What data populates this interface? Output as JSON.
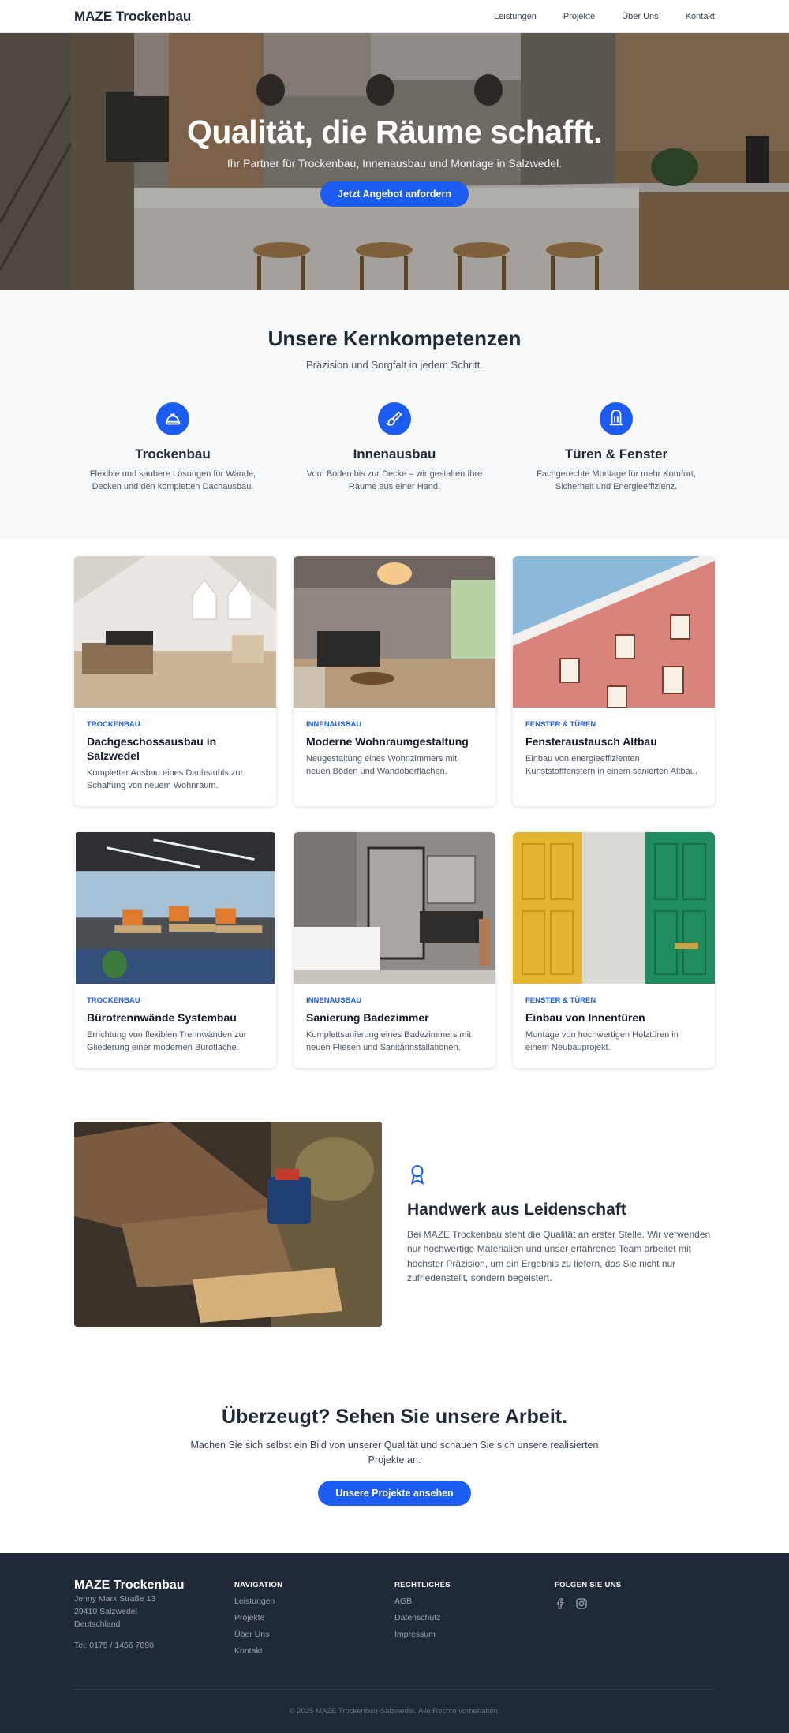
{
  "header": {
    "brand": "MAZE Trockenbau",
    "nav": [
      "Leistungen",
      "Projekte",
      "Über Uns",
      "Kontakt"
    ]
  },
  "hero": {
    "title": "Qualität, die Räume schafft.",
    "subtitle": "Ihr Partner für Trockenbau, Innenausbau und Montage in Salzwedel.",
    "cta_label": "Jetzt Angebot anfordern"
  },
  "competences": {
    "title": "Unsere Kernkompetenzen",
    "subtitle": "Präzision und Sorgfalt in jedem Schritt.",
    "items": [
      {
        "icon": "hard-hat-icon",
        "name": "Trockenbau",
        "desc": "Flexible und saubere Lösungen für Wände, Decken und den kompletten Dachausbau."
      },
      {
        "icon": "paint-brush-icon",
        "name": "Innenausbau",
        "desc": "Vom Boden bis zur Decke – wir gestalten Ihre Räume aus einer Hand."
      },
      {
        "icon": "door-icon",
        "name": "Türen & Fenster",
        "desc": "Fachgerechte Montage für mehr Komfort, Sicherheit und Energieeffizienz."
      }
    ]
  },
  "projects": [
    {
      "tag": "Trockenbau",
      "title": "Dachgeschossausbau in Salzwedel",
      "desc": "Kompletter Ausbau eines Dachstuhls zur Schaffung von neuem Wohnraum."
    },
    {
      "tag": "Innenausbau",
      "title": "Moderne Wohnraumgestaltung",
      "desc": "Neugestaltung eines Wohnzimmers mit neuen Böden und Wandoberflächen."
    },
    {
      "tag": "Fenster & Türen",
      "title": "Fensteraustausch Altbau",
      "desc": "Einbau von energieeffizienten Kunststofffenstern in einem sanierten Altbau."
    },
    {
      "tag": "Trockenbau",
      "title": "Bürotrennwände Systembau",
      "desc": "Errichtung von flexiblen Trennwänden zur Gliederung einer modernen Bürofläche."
    },
    {
      "tag": "Innenausbau",
      "title": "Sanierung Badezimmer",
      "desc": "Komplettsanierung eines Badezimmers mit neuen Fliesen und Sanitärinstallationen."
    },
    {
      "tag": "Fenster & Türen",
      "title": "Einbau von Innentüren",
      "desc": "Montage von hochwertigen Holztüren in einem Neubauprojekt."
    }
  ],
  "passion": {
    "icon": "award-ribbon-icon",
    "title": "Handwerk aus Leidenschaft",
    "desc": "Bei MAZE Trockenbau steht die Qualität an erster Stelle. Wir verwenden nur hochwertige Materialien und unser erfahrenes Team arbeitet mit höchster Präzision, um ein Ergebnis zu liefern, das Sie nicht nur zufriedenstellt, sondern begeistert."
  },
  "cta": {
    "title": "Überzeugt? Sehen Sie unsere Arbeit.",
    "desc": "Machen Sie sich selbst ein Bild von unserer Qualität und schauen Sie sich unsere realisierten Projekte an.",
    "button": "Unsere Projekte ansehen"
  },
  "footer": {
    "brand": "MAZE Trockenbau",
    "address": [
      "Jenny Marx Straße 13",
      "29410 Salzwedel",
      "Deutschland"
    ],
    "phone": "Tel: 0175 / 1456 7890",
    "nav_title": "Navigation",
    "nav_links": [
      "Leistungen",
      "Projekte",
      "Über Uns",
      "Kontakt"
    ],
    "legal_title": "Rechtliches",
    "legal_links": [
      "AGB",
      "Datenschutz",
      "Impressum"
    ],
    "social_title": "Folgen Sie uns",
    "social_icons": [
      "facebook-icon",
      "instagram-icon"
    ],
    "copyright": "© 2025 MAZE Trockenbau-Salzwedel. Alle Rechte vorbehalten."
  },
  "colors": {
    "accent": "#1d5cf0",
    "footer_bg": "#1f2937",
    "section_bg": "#f8f9fa"
  }
}
